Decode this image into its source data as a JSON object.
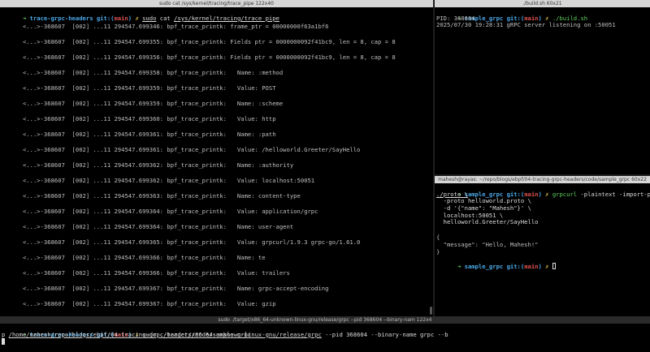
{
  "windows": {
    "trace_pipe": {
      "title": "sudo cat /sys/kernel/tracing/trace_pipe 122x40",
      "prompt": {
        "arrow": "➜",
        "cwd": "trace-grpc-headers",
        "git_label": "git:(",
        "branch": "main",
        "git_close": ")",
        "dirty": "✗",
        "cmd": "sudo",
        "args": "cat",
        "path": "/sys/kernel/tracing/trace_pipe"
      },
      "lines": [
        "      <...>-368607  [002] ...11 294547.699346: bpf_trace_printk: frame_ptr = 00000000f63a1bf6",
        "      <...>-368607  [002] ...11 294547.699355: bpf_trace_printk: Fields ptr = 0000000092f41bc9, len = 8, cap = 8",
        "      <...>-368607  [002] ...11 294547.699356: bpf_trace_printk: Fields ptr = 0000000092f41bc9, len = 8, cap = 8",
        "      <...>-368607  [002] ...11 294547.699358: bpf_trace_printk:   Name: :method",
        "      <...>-368607  [002] ...11 294547.699359: bpf_trace_printk:   Value: POST",
        "      <...>-368607  [002] ...11 294547.699359: bpf_trace_printk:   Name: :scheme",
        "      <...>-368607  [002] ...11 294547.699360: bpf_trace_printk:   Value: http",
        "      <...>-368607  [002] ...11 294547.699361: bpf_trace_printk:   Name: :path",
        "      <...>-368607  [002] ...11 294547.699361: bpf_trace_printk:   Value: /helloworld.Greeter/SayHello",
        "      <...>-368607  [002] ...11 294547.699362: bpf_trace_printk:   Name: :authority",
        "      <...>-368607  [002] ...11 294547.699362: bpf_trace_printk:   Value: localhost:50051",
        "      <...>-368607  [002] ...11 294547.699363: bpf_trace_printk:   Name: content-type",
        "      <...>-368607  [002] ...11 294547.699364: bpf_trace_printk:   Value: application/grpc",
        "      <...>-368607  [002] ...11 294547.699364: bpf_trace_printk:   Name: user-agent",
        "      <...>-368607  [002] ...11 294547.699365: bpf_trace_printk:   Value: grpcurl/1.9.3 grpc-go/1.61.0",
        "      <...>-368607  [002] ...11 294547.699366: bpf_trace_printk:   Name: te",
        "      <...>-368607  [002] ...11 294547.699366: bpf_trace_printk:   Value: trailers",
        "      <...>-368607  [002] ...11 294547.699367: bpf_trace_printk:   Name: grpc-accept-encoding",
        "      <...>-368607  [002] ...11 294547.699367: bpf_trace_printk:   Value: gzip"
      ]
    },
    "build": {
      "title": "./build.sh 60x21",
      "prompt": {
        "arrow": "➜",
        "cwd": "sample_grpc",
        "git_label": "git:(",
        "branch": "main",
        "git_close": ")",
        "dirty": "✗",
        "cmd": "./build.sh"
      },
      "lines": [
        "PID: 368604",
        "2025/07/30 19:28:31 gRPC server listening on :50051"
      ]
    },
    "grpcurl": {
      "title": "mahesh@rayas: ~/repo/blogs/ebpf/04-tracing-grpc-headers/code/sample_grpc 60x22",
      "prompt": {
        "arrow": "➜",
        "cwd": "sample_grpc",
        "git_label": "git:(",
        "branch": "main",
        "git_close": ")",
        "dirty": "✗",
        "cmd": "grpcurl",
        "args": "-plaintext -import-path"
      },
      "cont_lines": [
        "./proto \\",
        "  -proto helloworld.proto \\",
        "  -d '{\"name\": \"Mahesh\"}' \\",
        "  localhost:50051 \\",
        "  helloworld.Greeter/SayHello"
      ],
      "output_lines": [
        "{",
        "  \"message\": \"Hello, Mahesh!\"",
        "}"
      ],
      "prompt2": {
        "arrow": "➜",
        "cwd": "sample_grpc",
        "git_label": "git:(",
        "branch": "main",
        "git_close": ")",
        "dirty": "✗"
      }
    },
    "loader": {
      "title": "sudo ./target/x86_64-unknown-linux-gnu/release/grpc --pid 368604 --binary-nam 122x4",
      "prompt": {
        "arrow": "➜",
        "cwd": "trace-grpc-headers",
        "git_label": "git:(",
        "branch": "main",
        "git_close": ")",
        "dirty": "✗",
        "cmd": "sudo",
        "path": "./target/x86_64-unknown-linux-gnu/release/grpc",
        "args": "--pid 368604 --binary-name grpc --b"
      },
      "wrap_line": {
        "prefix": "p ",
        "path": "/home/mahesh/repo/blogs/ebpf/04-tracing-grpc-headers/code/sample_grpc"
      }
    }
  },
  "colors": {
    "prompt_arrow": "#5fd35f",
    "cwd": "#4aa8e8",
    "branch": "#e05050",
    "dirty": "#e0c040"
  }
}
